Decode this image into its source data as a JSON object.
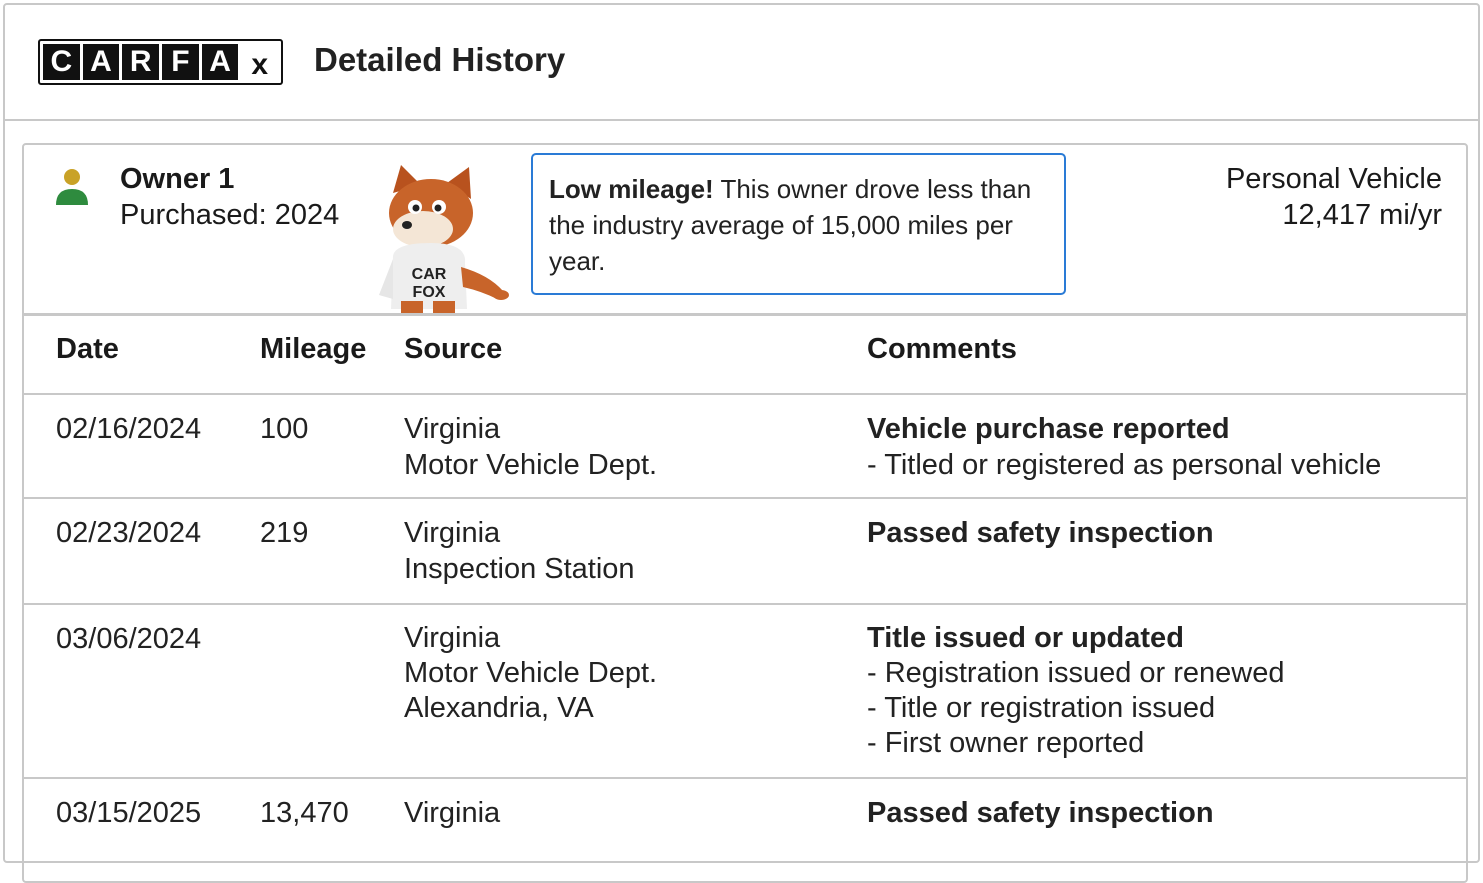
{
  "header": {
    "logo_letters": [
      "C",
      "A",
      "R",
      "F",
      "A",
      "x"
    ],
    "title": "Detailed History"
  },
  "owner": {
    "name": "Owner 1",
    "purchased": "Purchased: 2024",
    "icon": "person-icon",
    "callout_bold": "Low mileage!",
    "callout_text": " This owner drove less than the industry average of 15,000 miles per year.",
    "vehicle_type": "Personal Vehicle",
    "miles_per_year": "12,417 mi/yr",
    "mascot": "carfox-mascot",
    "mascot_shirt_text": "CAR FOX"
  },
  "table": {
    "headers": [
      "Date",
      "Mileage",
      "Source",
      "Comments"
    ],
    "rows": [
      {
        "date": "02/16/2024",
        "mileage": "100",
        "source": [
          "Virginia",
          "Motor Vehicle Dept."
        ],
        "comment_title": "Vehicle purchase reported",
        "comment_items": [
          "- Titled or registered as personal vehicle"
        ]
      },
      {
        "date": "02/23/2024",
        "mileage": "219",
        "source": [
          "Virginia",
          "Inspection Station"
        ],
        "comment_title": "Passed safety inspection",
        "comment_items": []
      },
      {
        "date": "03/06/2024",
        "mileage": "",
        "source": [
          "Virginia",
          "Motor Vehicle Dept.",
          "Alexandria, VA"
        ],
        "comment_title": "Title issued or updated",
        "comment_items": [
          "- Registration issued or renewed",
          "- Title or registration issued",
          "- First owner reported"
        ]
      },
      {
        "date": "03/15/2025",
        "mileage": "13,470",
        "source": [
          "Virginia"
        ],
        "comment_title": "Passed safety inspection",
        "comment_items": []
      }
    ]
  },
  "colors": {
    "accent_blue": "#2a7bd6",
    "owner_icon_head": "#c9a227",
    "owner_icon_body": "#2e8b3e",
    "border_gray": "#c8c8c8"
  }
}
